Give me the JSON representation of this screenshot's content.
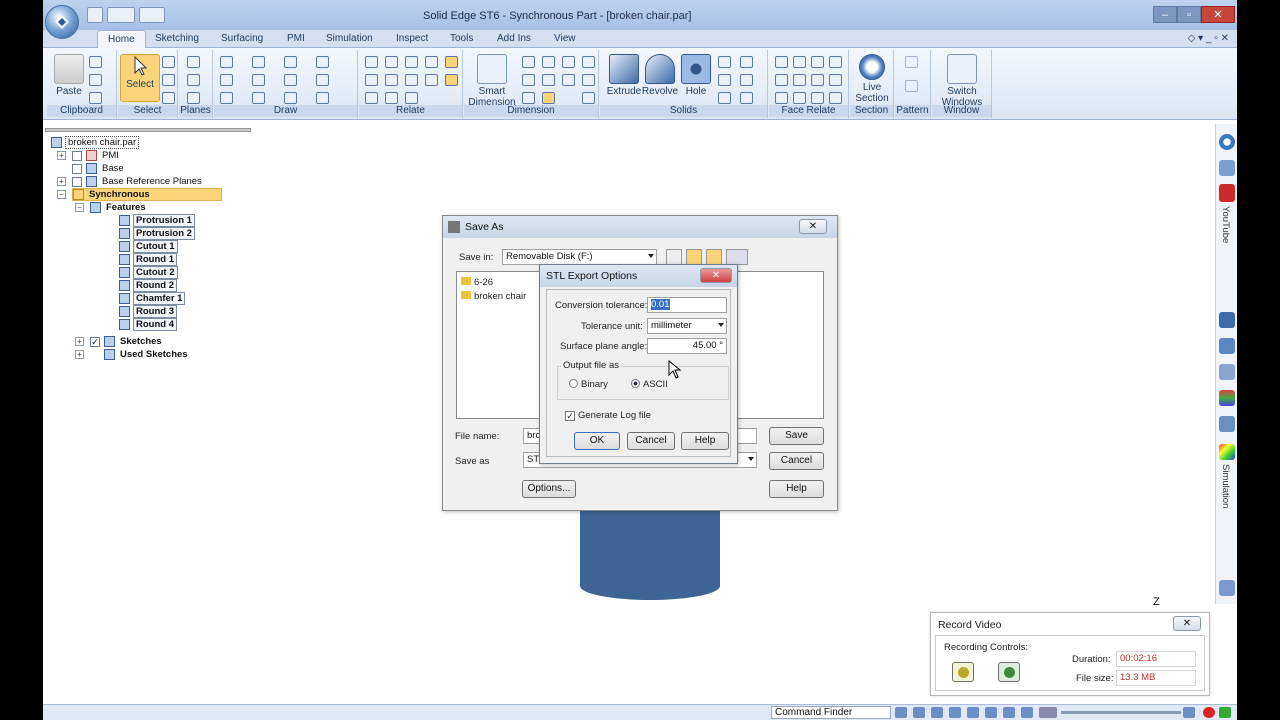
{
  "window": {
    "title": "Solid Edge ST6 - Synchronous Part - [broken chair.par]"
  },
  "tabs": [
    "Home",
    "Sketching",
    "Surfacing",
    "PMI",
    "Simulation",
    "Inspect",
    "Tools",
    "Add Ins",
    "View"
  ],
  "ribbon": {
    "groups": [
      "Clipboard",
      "Select",
      "Planes",
      "Draw",
      "Relate",
      "Dimension",
      "Solids",
      "Face Relate",
      "Section",
      "Pattern",
      "Window"
    ],
    "buttons": {
      "paste": "Paste",
      "select": "Select",
      "smart_dimension_1": "Smart",
      "smart_dimension_2": "Dimension",
      "extrude": "Extrude",
      "revolve": "Revolve",
      "hole": "Hole",
      "live_section_1": "Live",
      "live_section_2": "Section",
      "switch_windows_1": "Switch",
      "switch_windows_2": "Windows"
    }
  },
  "tree": {
    "root": "broken chair.par",
    "pmi": "PMI",
    "base": "Base",
    "base_planes": "Base Reference Planes",
    "synchronous": "Synchronous",
    "features": "Features",
    "items": [
      "Protrusion 1",
      "Protrusion 2",
      "Cutout 1",
      "Round 1",
      "Cutout 2",
      "Round 2",
      "Chamfer 1",
      "Round 3",
      "Round 4"
    ],
    "sketches": "Sketches",
    "used_sketches": "Used Sketches"
  },
  "rightbar": {
    "youtube": "YouTube",
    "simulation": "Simulation"
  },
  "save_as": {
    "title": "Save As",
    "save_in_label": "Save in:",
    "save_in_value": "Removable Disk (F:)",
    "files": [
      "6-26",
      "broken chair"
    ],
    "file_name_label": "File name:",
    "file_name_value": "brok",
    "save_as_label": "Save as",
    "save_as_value": "ST",
    "save": "Save",
    "cancel": "Cancel",
    "options": "Options...",
    "help": "Help"
  },
  "stl": {
    "title": "STL Export Options",
    "conv_tol_label": "Conversion tolerance:",
    "conv_tol_value": "0.01",
    "tol_unit_label": "Tolerance unit:",
    "tol_unit_value": "millimeter",
    "surf_angle_label": "Surface plane angle:",
    "surf_angle_value": "45.00 °",
    "output_label": "Output file as",
    "binary": "Binary",
    "ascii": "ASCII",
    "gen_log": "Generate Log file",
    "ok": "OK",
    "cancel": "Cancel",
    "help": "Help"
  },
  "record": {
    "title": "Record Video",
    "controls": "Recording Controls:",
    "duration_label": "Duration:",
    "duration_value": "00:02:16",
    "filesize_label": "File size:",
    "filesize_value": "13.3 MB"
  },
  "status": {
    "command_finder": "Command Finder"
  },
  "axis_label": "Z"
}
